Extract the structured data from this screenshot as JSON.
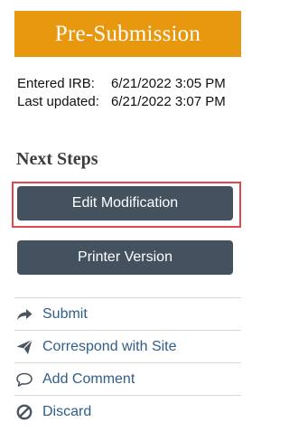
{
  "status": {
    "label": "Pre-Submission",
    "color": "#e8980f"
  },
  "dates": {
    "entered_label": "Entered IRB:",
    "entered_value": "6/21/2022 3:05 PM",
    "updated_label": "Last updated:",
    "updated_value": "6/21/2022 3:07 PM"
  },
  "next_steps": {
    "title": "Next Steps",
    "primary_buttons": [
      {
        "label": "Edit Modification",
        "highlighted": true
      },
      {
        "label": "Printer Version",
        "highlighted": false
      }
    ],
    "actions": [
      {
        "label": "Submit",
        "icon": "share-arrow-icon"
      },
      {
        "label": "Correspond with Site",
        "icon": "paper-plane-icon"
      },
      {
        "label": "Add Comment",
        "icon": "comment-bubble-icon"
      },
      {
        "label": "Discard",
        "icon": "prohibited-icon"
      }
    ]
  },
  "colors": {
    "button_bg": "#44525f",
    "link": "#2f5e88",
    "highlight": "#e0484f"
  }
}
